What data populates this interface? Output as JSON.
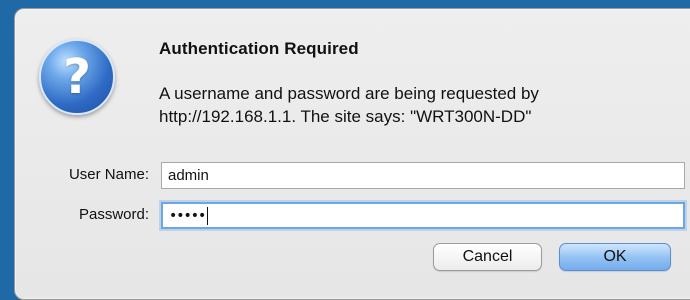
{
  "dialog": {
    "icon": "question-mark-icon",
    "title": "Authentication Required",
    "message": "A username and password are being requested by http://192.168.1.1. The site says: \"WRT300N-DD\"",
    "user_name_label": "User Name:",
    "user_name_value": "admin",
    "password_label": "Password:",
    "password_masked": "•••••",
    "cancel_label": "Cancel",
    "ok_label": "OK"
  },
  "colors": {
    "background_blue": "#1f6aa6",
    "dialog_gray": "#eeeeee",
    "focus_blue": "#69a7e6"
  }
}
